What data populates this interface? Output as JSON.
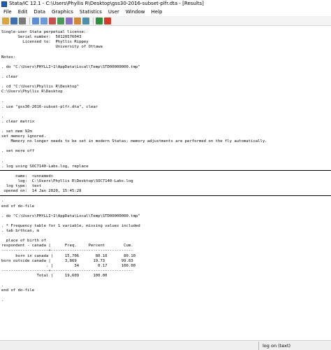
{
  "window": {
    "title": "Stata/IC 12.1 - C:\\Users\\Phyllis R\\Desktop\\gss30-2016-subset-plfr.dta - [Results]"
  },
  "menu": [
    "File",
    "Edit",
    "Data",
    "Graphics",
    "Statistics",
    "User",
    "Window",
    "Help"
  ],
  "toolbar": {
    "buttons": [
      {
        "name": "open-icon",
        "color": "#d9a441"
      },
      {
        "name": "save-icon",
        "color": "#3b6fb6"
      },
      {
        "name": "print-icon",
        "color": "#7a7a7a"
      },
      {
        "name": "log-icon",
        "color": "#5b8fd1"
      },
      {
        "name": "viewer-icon",
        "color": "#6a9bd8"
      },
      {
        "name": "graph-icon",
        "color": "#c94f4f"
      },
      {
        "name": "do-file-editor-icon",
        "color": "#4c9a5a"
      },
      {
        "name": "data-editor-icon",
        "color": "#8a6fc2"
      },
      {
        "name": "data-browser-icon",
        "color": "#d08a3a"
      },
      {
        "name": "variables-manager-icon",
        "color": "#4f8fa8"
      },
      {
        "name": "more-icon",
        "color": "#2f8f3f"
      },
      {
        "name": "break-icon",
        "color": "#d23a2a"
      }
    ]
  },
  "results": {
    "lines": [
      "Single-user Stata perpetual license:",
      "       Serial number:  50120576043",
      "         Licensed to:  Phyllis Rippey",
      "                       University of Ottawa",
      "",
      "Notes:",
      "",
      ". do \"C:\\Users\\PHYLLI~1\\AppData\\Local\\Temp\\STD00000000.tmp\"",
      "",
      ". clear",
      "",
      ". cd \"C:\\Users\\Phyllis R\\Desktop\"",
      "C:\\Users\\Phyllis R\\Desktop",
      "",
      ".",
      ". use \"gss30-2016-subset-plfr.dta\", clear",
      "",
      ".",
      ". clear matrix",
      "",
      ". set mem 92m",
      "set memory ignored.",
      "    Memory no longer needs to be set in modern Statas; memory adjustments are performed on the fly automatically.",
      "",
      ". set more off",
      "",
      ".",
      ". log using SOC7140-Labs.log, replace",
      "",
      "      name:  <unnamed>",
      "       log:  C:\\Users\\Phyllis R\\Desktop\\SOC7140-Labs.log",
      "  log type:  text",
      " opened on:  14 Jan 2020, 15:45:28",
      "",
      ".",
      "end of do-file",
      "",
      ". do \"C:\\Users\\PHYLLI~1\\AppData\\Local\\Temp\\STD00000000.tmp\"",
      "",
      ". * Frequency table for 1 variable, missing values included",
      ". tab brthcan, m",
      "",
      "  place of birth of",
      "respondent - canada |      Freq.     Percent        Cum.",
      "--------------------+-----------------------------------",
      "      born in canada |     15,706       80.10       80.10",
      "born outside canada |      3,869       19.73       99.83",
      "                   . |         34        0.17      100.00",
      "--------------------+-----------------------------------",
      "               Total |     19,609      100.00",
      "",
      ".",
      "end of do-file",
      "",
      "."
    ]
  },
  "statusbar": {
    "text": "log on (text)"
  }
}
